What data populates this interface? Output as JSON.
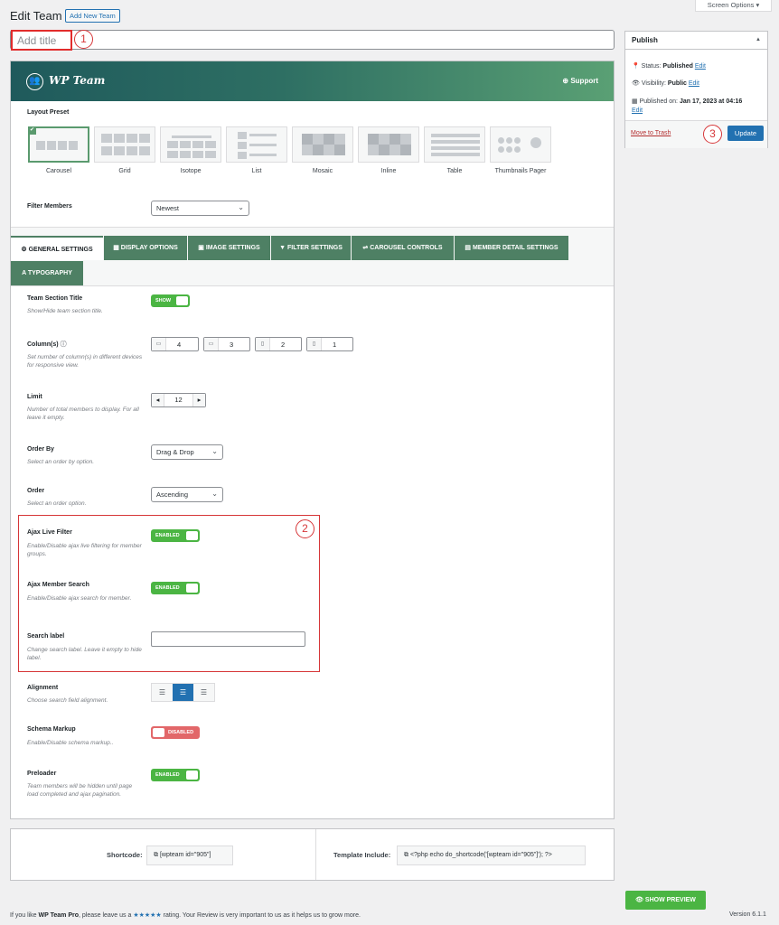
{
  "header": {
    "title": "Edit Team",
    "add_new": "Add New Team",
    "screen_options": "Screen Options ▾"
  },
  "title_input": {
    "placeholder": "Add title"
  },
  "markers": [
    "1",
    "2",
    "3"
  ],
  "publish": {
    "title": "Publish",
    "status_label": "Status:",
    "status_value": "Published",
    "status_edit": "Edit",
    "visibility_label": "Visibility:",
    "visibility_value": "Public",
    "visibility_edit": "Edit",
    "published_label": "Published on:",
    "published_value": "Jan 17, 2023 at 04:16",
    "published_edit": "Edit",
    "trash": "Move to Trash",
    "update": "Update"
  },
  "banner": {
    "title": "WP Team",
    "support": "Support"
  },
  "layout": {
    "label": "Layout Preset",
    "presets": [
      "Carousel",
      "Grid",
      "Isotope",
      "List",
      "Mosaic",
      "Inline",
      "Table",
      "Thumbnails Pager"
    ],
    "selected": "Carousel"
  },
  "filter_members": {
    "label": "Filter Members",
    "value": "Newest"
  },
  "tabs": [
    "GENERAL SETTINGS",
    "DISPLAY OPTIONS",
    "IMAGE SETTINGS",
    "FILTER SETTINGS",
    "CAROUSEL CONTROLS",
    "MEMBER DETAIL SETTINGS",
    "TYPOGRAPHY"
  ],
  "fields": {
    "team_section_title": {
      "label": "Team Section Title",
      "desc": "Show/Hide team section title.",
      "toggle": "SHOW"
    },
    "columns": {
      "label": "Column(s)",
      "desc": "Set number of column(s) in different devices for responsive view.",
      "values": [
        "4",
        "3",
        "2",
        "1"
      ]
    },
    "limit": {
      "label": "Limit",
      "desc": "Number of total members to display. For all leave it empty.",
      "value": "12"
    },
    "order_by": {
      "label": "Order By",
      "desc": "Select an order by option.",
      "value": "Drag & Drop"
    },
    "order": {
      "label": "Order",
      "desc": "Select an order option.",
      "value": "Ascending"
    },
    "ajax_live_filter": {
      "label": "Ajax Live Filter",
      "desc": "Enable/Disable ajax live filtering for member groups.",
      "toggle": "ENABLED"
    },
    "ajax_member_search": {
      "label": "Ajax Member Search",
      "desc": "Enable/Disable ajax search for member.",
      "toggle": "ENABLED"
    },
    "search_label": {
      "label": "Search label",
      "desc": "Change search label. Leave it empty to hide label.",
      "value": ""
    },
    "alignment": {
      "label": "Alignment",
      "desc": "Choose search field alignment.",
      "selected": "center"
    },
    "schema_markup": {
      "label": "Schema Markup",
      "desc": "Enable/Disable schema markup..",
      "toggle": "DISABLED"
    },
    "preloader": {
      "label": "Preloader",
      "desc": "Team members will be hidden until page load completed and ajax pagination.",
      "toggle": "ENABLED"
    }
  },
  "shortcode": {
    "label": "Shortcode:",
    "value": "[wpteam id=\"905\"]",
    "template_label": "Template Include:",
    "template_value": "<?php echo do_shortcode('[wpteam id=\"905\"]'); ?>"
  },
  "preview": "SHOW PREVIEW",
  "footer": {
    "prefix": "If you like ",
    "brand": "WP Team Pro",
    "mid": ", please leave us a ",
    "stars": "★★★★★",
    "suffix": " rating. Your Review is very important to us as it helps us to grow more.",
    "version": "Version 6.1.1"
  },
  "colors": {
    "accent_green": "#4e8064",
    "toggle_on": "#4bb543",
    "toggle_off": "#e26769",
    "wp_blue": "#2271b1",
    "marker_red": "#d63638"
  }
}
